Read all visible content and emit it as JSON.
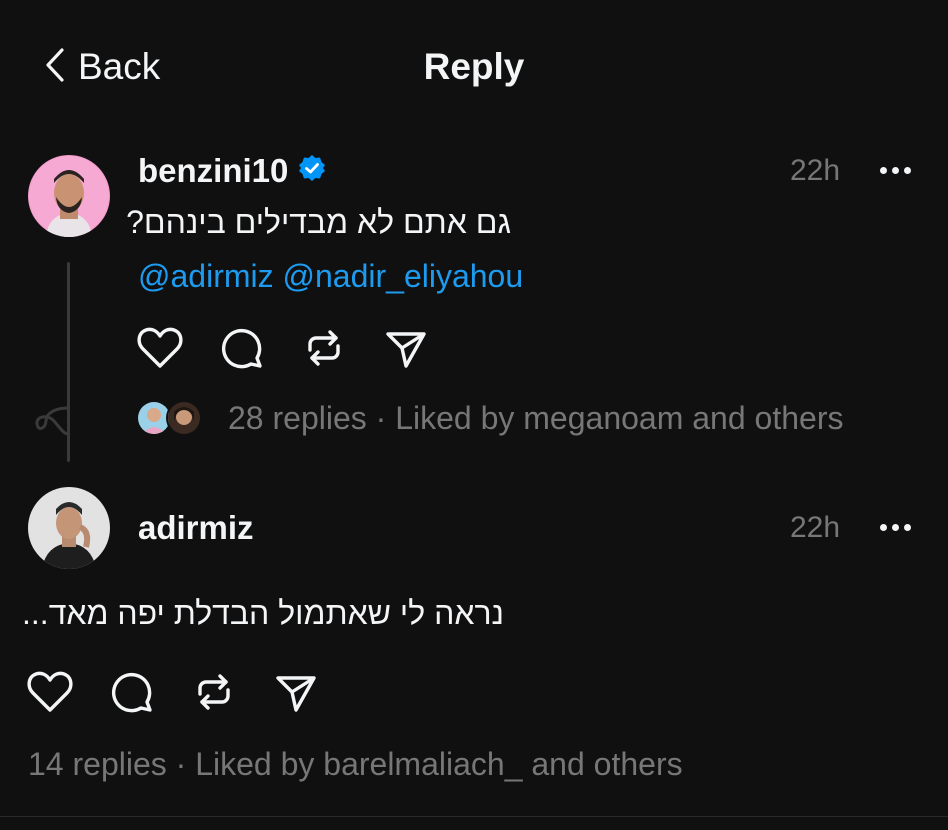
{
  "header": {
    "back_label": "Back",
    "title": "Reply"
  },
  "post": {
    "username": "benzini10",
    "verified": true,
    "time": "22h",
    "text": "גם אתם לא מבדילים בינהם?",
    "mentions": "@adirmiz @nadir_eliyahou",
    "replies": "28 replies",
    "liked_by": "· Liked by meganoam and others"
  },
  "reply": {
    "username": "adirmiz",
    "time": "22h",
    "text": "נראה לי שאתמול הבדלת יפה מאד...",
    "replies": "14 replies",
    "liked_by": "· Liked by barelmaliach_ and others"
  },
  "colors": {
    "background": "#101010",
    "text": "#f3f5f7",
    "muted": "#777777",
    "link": "#1d9bf0",
    "verified": "#0095f6"
  },
  "icons": [
    "chevron-left-icon",
    "verified-badge-icon",
    "more-icon",
    "heart-icon",
    "comment-icon",
    "repost-icon",
    "share-icon"
  ]
}
